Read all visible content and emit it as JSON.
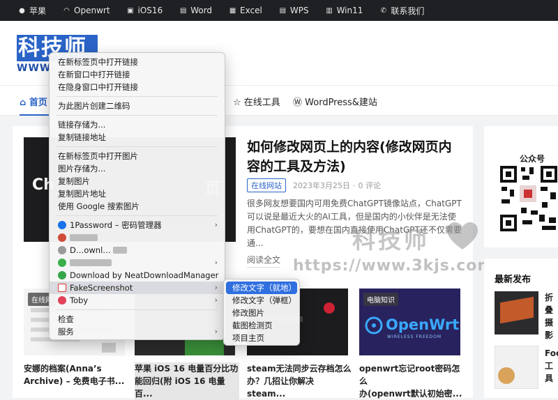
{
  "topbar": {
    "items": [
      {
        "icon": "apple-icon",
        "label": "苹果"
      },
      {
        "icon": "wifi-icon",
        "label": "Openwrt"
      },
      {
        "icon": "ios-icon",
        "label": "iOS16"
      },
      {
        "icon": "word-icon",
        "label": "Word"
      },
      {
        "icon": "excel-icon",
        "label": "Excel"
      },
      {
        "icon": "wps-icon",
        "label": "WPS"
      },
      {
        "icon": "windows-icon",
        "label": "Win11"
      },
      {
        "icon": "phone-icon",
        "label": "联系我们"
      }
    ]
  },
  "logo": {
    "main": "科技师",
    "url": "WWW."
  },
  "nav": {
    "home": "首页",
    "online_tools": "在线工具",
    "wordpress": "WordPress&建站"
  },
  "featured": {
    "image_text_left": "Ch",
    "image_text_right": "页",
    "title": "如何修改网页上的内容(修改网页内容的工具及方法)",
    "tag": "在线网站",
    "date": "2023年3月25日",
    "comments": "0 评论",
    "excerpt": "很多网友想要国内可用免费ChatGPT镜像站点，ChatGPT可以说是最近大火的AI工具，但是国内的小伙伴是无法使用ChatGPT的，要想在国内直接使用ChatGPT还不仅需要通...",
    "read_more": "阅读全文"
  },
  "watermark": {
    "text": "科技师",
    "url": "https://www.3kjs.com"
  },
  "cards": [
    {
      "badge": "在线网",
      "title_l1": "安娜的档案(Anna’s",
      "title_l2": "Archive) – 免费电子书..."
    },
    {
      "badge": "",
      "title_l1": "苹果 iOS 16 电量百分比功",
      "title_l2": "能回归(附 iOS 16 电量百..."
    },
    {
      "badge": "",
      "title_l1": "steam无法同步云存档怎么",
      "title_l2": "办？几招让你解决steam..."
    },
    {
      "badge": "电脑知识",
      "title_l1": "openwrt忘记root密码怎么",
      "title_l2": "办(openwrt默认初始密..."
    }
  ],
  "openwrt_brand": {
    "name": "OpenWrt",
    "sub": "WIRELESS FREEDOM"
  },
  "sidebar": {
    "wechat_title": "公众号",
    "recent_title": "最新发布",
    "recent_1": "折叠",
    "recent_1b": "摄影",
    "recent_2": "Foc",
    "recent_2b": "工具"
  },
  "context_menu": {
    "items": [
      "在新标签页中打开链接",
      "在新窗口中打开链接",
      "在隐身窗口中打开链接",
      "为此图片创建二维码",
      "链接存储为...",
      "复制链接地址",
      "在新标签页中打开图片",
      "图片存储为...",
      "复制图片",
      "复制图片地址",
      "使用 Google 搜索图片",
      "1Password – 密码管理器",
      "Download by NeatDownloadManager",
      "FakeScreenshot",
      "Toby",
      "检查",
      "服务"
    ],
    "partial_1": "缓…",
    "partial_2": "D…ownl…"
  },
  "submenu": {
    "items": [
      "修改文字（就地）",
      "修改文字（弹框）",
      "修改图片",
      "截图检测页",
      "项目主页"
    ]
  },
  "colors": {
    "accent": "#2a64c7",
    "topbar_bg": "#1f2023",
    "highlight": "#2f6fe0"
  }
}
